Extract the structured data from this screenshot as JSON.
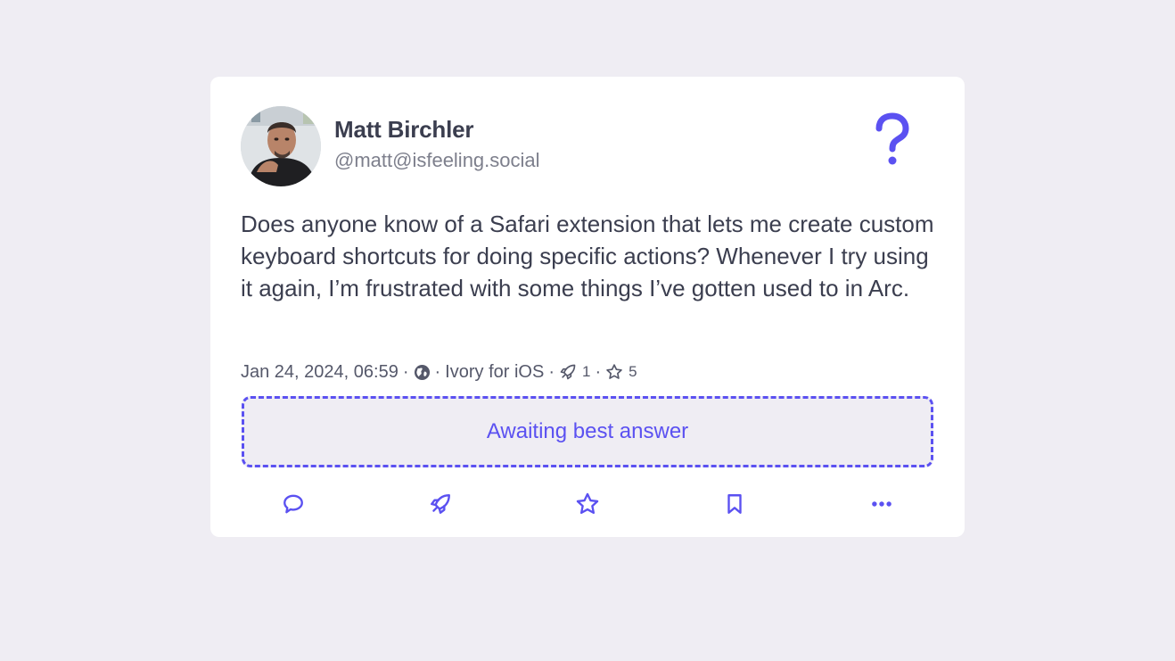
{
  "post": {
    "author": {
      "name": "Matt Birchler",
      "handle": "@matt@isfeeling.social"
    },
    "badge_icon": "question-mark-icon",
    "text": "Does anyone know of a Safari extension that lets me create custom keyboard shortcuts for doing specific actions? Whenever I try using it again, I’m frustrated with some things I’ve gotten used to in Arc.",
    "meta": {
      "timestamp": "Jan 24, 2024, 06:59",
      "separator": "·",
      "visibility_icon": "globe-icon",
      "client": "Ivory for iOS",
      "boost_count": "1",
      "favourite_count": "5"
    },
    "awaiting_label": "Awaiting best answer",
    "actions": [
      "reply-icon",
      "boost-icon",
      "favourite-icon",
      "bookmark-icon",
      "more-icon"
    ]
  },
  "colors": {
    "accent": "#5b51f1",
    "text": "#3b3e4f",
    "muted": "#7d7f8c",
    "page_bg": "#efedf3",
    "card_bg": "#ffffff"
  }
}
